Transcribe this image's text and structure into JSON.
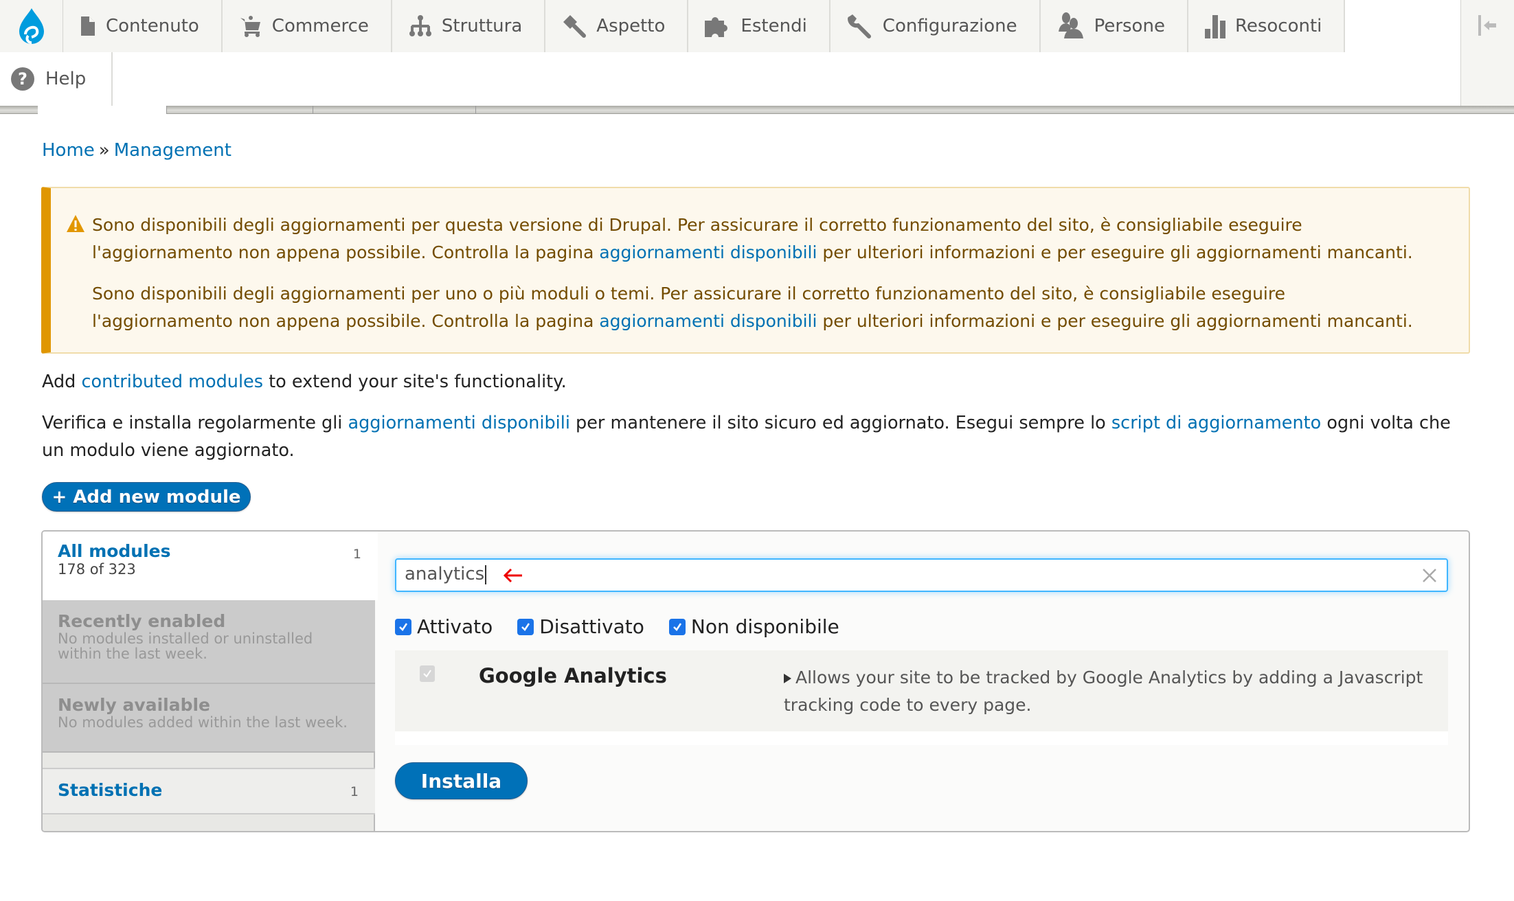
{
  "toolbar": {
    "items": [
      {
        "label": "Contenuto",
        "icon": "file-icon"
      },
      {
        "label": "Commerce",
        "icon": "cart-icon"
      },
      {
        "label": "Struttura",
        "icon": "sitemap-icon"
      },
      {
        "label": "Aspetto",
        "icon": "paintbrush-icon"
      },
      {
        "label": "Estendi",
        "icon": "puzzle-icon"
      },
      {
        "label": "Configurazione",
        "icon": "wrench-icon"
      },
      {
        "label": "Persone",
        "icon": "people-icon"
      },
      {
        "label": "Resoconti",
        "icon": "bar-chart-icon"
      }
    ],
    "help_label": "Help"
  },
  "breadcrumb": {
    "home": "Home",
    "separator": "»",
    "current": "Management"
  },
  "warning": {
    "messages": [
      {
        "line1": "Sono disponibili degli aggiornamenti per questa versione di Drupal. Per assicurare il corretto funzionamento del sito, è consigliabile eseguire",
        "before_link": "l'aggiornamento non appena possibile. Controlla la pagina ",
        "link": "aggiornamenti disponibili",
        "after_link": " per ulteriori informazioni e per eseguire gli aggiornamenti mancanti."
      },
      {
        "line1": "Sono disponibili degli aggiornamenti per uno o più moduli o temi. Per assicurare il corretto funzionamento del sito, è consigliabile eseguire",
        "before_link": "l'aggiornamento non appena possibile. Controlla la pagina ",
        "link": "aggiornamenti disponibili",
        "after_link": " per ulteriori informazioni e per eseguire gli aggiornamenti mancanti."
      }
    ],
    "accent_color": "#e09600"
  },
  "intro": {
    "add_before": "Add ",
    "add_link": "contributed modules",
    "add_after": " to extend your site's functionality.",
    "verify_before": "Verifica e installa regolarmente gli ",
    "verify_link1": "aggiornamenti disponibili",
    "verify_middle": " per mantenere il sito sicuro ed aggiornato. Esegui sempre lo ",
    "verify_link2": "script di aggiornamento",
    "verify_after": " ogni volta che un modulo viene aggiornato."
  },
  "add_module_button": "+ Add new module",
  "sidebar": {
    "all_modules": {
      "title": "All modules",
      "count": "1",
      "subtitle": "178 of 323"
    },
    "recently_enabled": {
      "title": "Recently enabled",
      "subtitle": "No modules installed or uninstalled within the last week."
    },
    "newly_available": {
      "title": "Newly available",
      "subtitle": "No modules added within the last week."
    },
    "categories": [
      {
        "title": "Statistiche",
        "count": "1"
      }
    ]
  },
  "filter": {
    "search_value": "analytics",
    "checkboxes": [
      {
        "label": "Attivato",
        "checked": true
      },
      {
        "label": "Disattivato",
        "checked": true
      },
      {
        "label": "Non disponibile",
        "checked": true
      }
    ]
  },
  "modules": [
    {
      "name": "Google Analytics",
      "checked": true,
      "disabled": true,
      "description": "Allows your site to be tracked by Google Analytics by adding a Javascript tracking code to every page."
    }
  ],
  "install_button": "Installa",
  "colors": {
    "primary": "#0071b8",
    "link": "#0071b3",
    "focus": "#40b6ff"
  }
}
